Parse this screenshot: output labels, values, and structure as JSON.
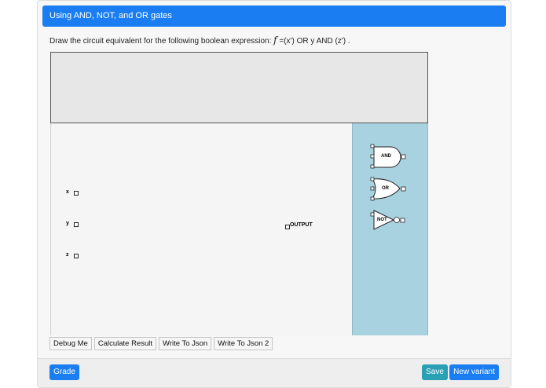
{
  "header": {
    "title": "Using AND, NOT, and OR gates"
  },
  "question": {
    "prefix": "Draw the circuit equivalent for the following boolean expression: ",
    "function_symbol": "f",
    "expression": " =(x') OR y AND (z') ."
  },
  "inputs": [
    {
      "label": "x"
    },
    {
      "label": "y"
    },
    {
      "label": "z"
    }
  ],
  "output": {
    "label": "OUTPUT"
  },
  "palette": {
    "and_label": "AND",
    "or_label": "OR",
    "not_label": "NOT"
  },
  "toolbar": {
    "debug_label": "Debug Me",
    "calculate_label": "Calculate Result",
    "write_json_label": "Write To Json",
    "write_json2_label": "Write To Json 2"
  },
  "footer": {
    "grade_label": "Grade",
    "save_label": "Save",
    "new_variant_label": "New variant"
  },
  "colors": {
    "header": "#1a7ef2",
    "palette_bg": "#a9d2e0",
    "save": "#2aa0b4"
  }
}
